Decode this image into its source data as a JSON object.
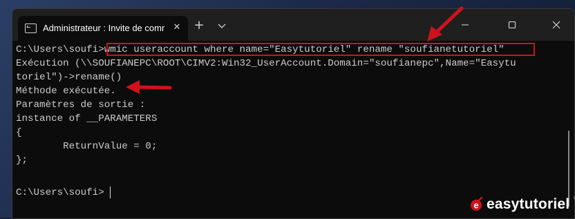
{
  "window": {
    "tab_title": "Administrateur : Invite de comm",
    "tab_close": "✕",
    "new_tab": "+",
    "controls": {
      "minimize": "minimize",
      "maximize": "maximize",
      "close": "close"
    }
  },
  "terminal": {
    "lines": [
      "C:\\Users\\soufi>wmic useraccount where name=\"Easytutoriel\" rename \"soufianetutoriel\"",
      "Exécution (\\\\SOUFIANEPC\\ROOT\\CIMV2:Win32_UserAccount.Domain=\"soufianepc\",Name=\"Easytu",
      "toriel\")->rename()",
      "Méthode exécutée.",
      "Paramètres de sortie :",
      "instance of __PARAMETERS",
      "{",
      "        ReturnValue = 0;",
      "};",
      "",
      "C:\\Users\\soufi>"
    ]
  },
  "annotations": {
    "highlight_color": "#d0121b",
    "arrow_color": "#d0121b"
  },
  "watermark": {
    "brand": "easytutoriel",
    "trademark": "®"
  },
  "colors": {
    "terminal_bg": "#0c0c0c",
    "terminal_text": "#cccccc",
    "titlebar_bg": "#1f1f1f"
  }
}
